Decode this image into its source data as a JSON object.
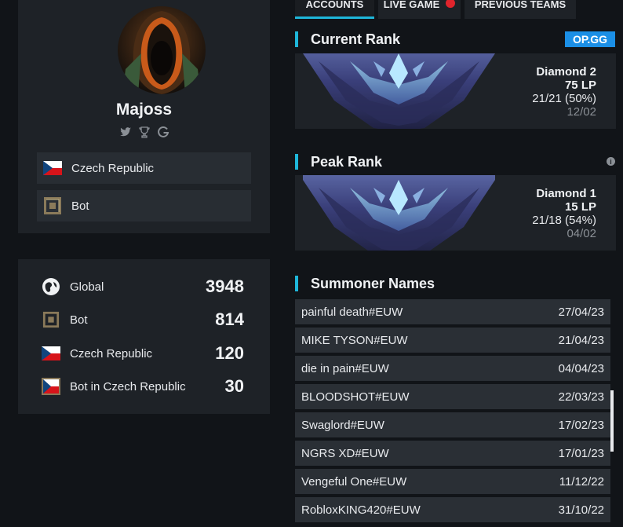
{
  "profile": {
    "name": "Majoss",
    "tags": [
      {
        "label": "Czech Republic",
        "icon": "czech-flag-icon"
      },
      {
        "label": "Bot",
        "icon": "bot-role-icon"
      }
    ],
    "socials": [
      "twitter-icon",
      "trophy-icon",
      "gamepedia-icon"
    ]
  },
  "stats": [
    {
      "label": "Global",
      "value": "3948",
      "icon": "globe-icon"
    },
    {
      "label": "Bot",
      "value": "814",
      "icon": "bot-role-icon"
    },
    {
      "label": "Czech Republic",
      "value": "120",
      "icon": "czech-flag-icon"
    },
    {
      "label": "Bot in Czech Republic",
      "value": "30",
      "icon": "bot-czech-flag-icon"
    }
  ],
  "tabs": [
    {
      "label": "ACCOUNTS",
      "active": true
    },
    {
      "label": "LIVE GAME",
      "active": false
    },
    {
      "label": "PREVIOUS TEAMS",
      "active": false
    }
  ],
  "current_rank": {
    "title": "Current Rank",
    "badge": "OP.GG",
    "tier": "Diamond 2",
    "lp": "75 LP",
    "record": "21/21 (50%)",
    "date": "12/02"
  },
  "peak_rank": {
    "title": "Peak Rank",
    "tier": "Diamond 1",
    "lp": "15 LP",
    "record": "21/18 (54%)",
    "date": "04/02"
  },
  "summoner_names": {
    "title": "Summoner Names",
    "rows": [
      {
        "name": "painful death#EUW",
        "date": "27/04/23"
      },
      {
        "name": "MIKE TYSON#EUW",
        "date": "21/04/23"
      },
      {
        "name": "die in pain#EUW",
        "date": "04/04/23"
      },
      {
        "name": "BLOODSHOT#EUW",
        "date": "22/03/23"
      },
      {
        "name": "Swaglord#EUW",
        "date": "17/02/23"
      },
      {
        "name": "NGRS XD#EUW",
        "date": "17/01/23"
      },
      {
        "name": "Vengeful One#EUW",
        "date": "11/12/22"
      },
      {
        "name": "RobloxKING420#EUW",
        "date": "31/10/22"
      }
    ]
  },
  "colors": {
    "accent": "#1eb6d9",
    "live": "#e0242c",
    "opgg": "#1b8fe6"
  }
}
